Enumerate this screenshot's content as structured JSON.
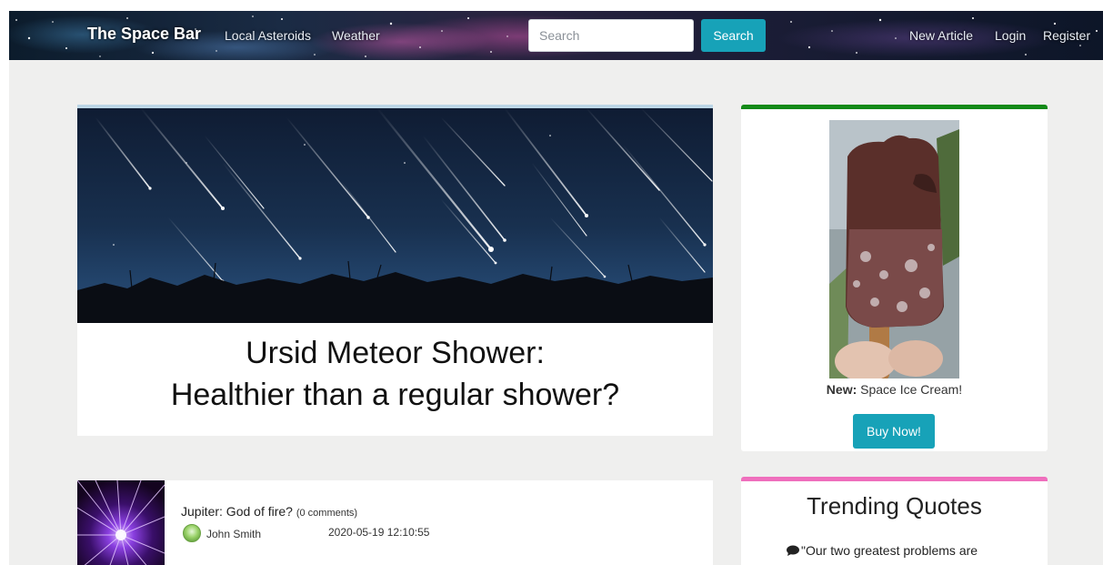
{
  "navbar": {
    "brand": "The Space Bar",
    "links": {
      "local_asteroids": "Local Asteroids",
      "weather": "Weather",
      "new_article": "New Article",
      "login": "Login",
      "register": "Register"
    },
    "search": {
      "placeholder": "Search",
      "value": "",
      "button_label": "Search"
    }
  },
  "hero": {
    "title_line1": "Ursid Meteor Shower:",
    "title_line2": "Healthier than a regular shower?"
  },
  "ad": {
    "label_bold": "New:",
    "label_text": " Space Ice Cream!",
    "button_label": "Buy Now!"
  },
  "article": {
    "title": "Jupiter: God of fire?",
    "comments": "(0 comments)",
    "author": "John Smith",
    "date": "2020-05-19 12:10:55"
  },
  "quotes": {
    "title": "Trending Quotes",
    "first_quote": "\"Our two greatest problems are"
  },
  "colors": {
    "accent": "#17a2b8",
    "ad_border": "#138a18",
    "quotes_border": "#ef6fbd",
    "hero_border": "#bcd6e6",
    "page_background": "#efefee"
  },
  "icons": {
    "quote": "comment-icon"
  }
}
